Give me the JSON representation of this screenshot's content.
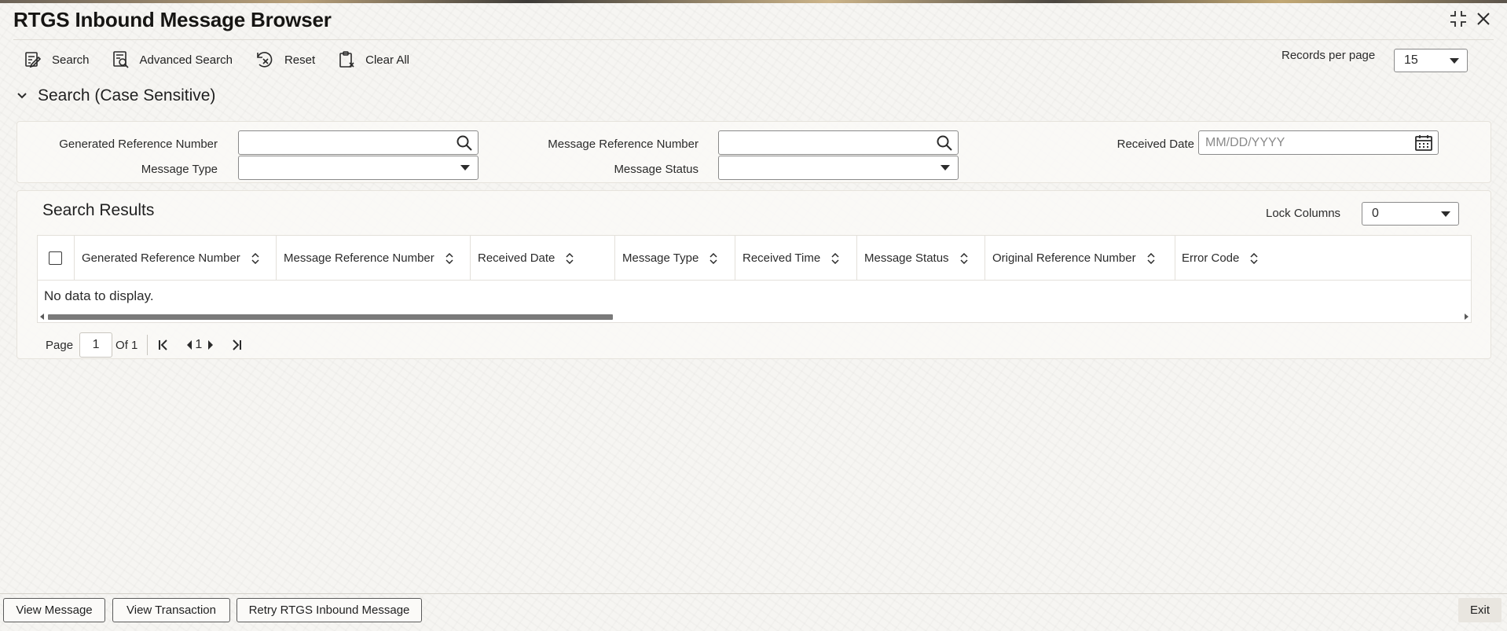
{
  "window": {
    "title": "RTGS Inbound Message Browser"
  },
  "toolbar": {
    "search_label": "Search",
    "advanced_search_label": "Advanced Search",
    "reset_label": "Reset",
    "clear_all_label": "Clear All"
  },
  "records_per_page": {
    "label": "Records per page",
    "value": "15"
  },
  "search_section": {
    "title": "Search (Case Sensitive)",
    "fields": {
      "generated_reference_number": {
        "label": "Generated Reference Number",
        "value": ""
      },
      "message_reference_number": {
        "label": "Message Reference Number",
        "value": ""
      },
      "received_date": {
        "label": "Received Date",
        "placeholder": "MM/DD/YYYY",
        "value": ""
      },
      "message_type": {
        "label": "Message Type",
        "value": ""
      },
      "message_status": {
        "label": "Message Status",
        "value": ""
      }
    }
  },
  "results": {
    "title": "Search Results",
    "lock_columns": {
      "label": "Lock Columns",
      "value": "0"
    },
    "columns": [
      "Generated Reference Number",
      "Message Reference Number",
      "Received Date",
      "Message Type",
      "Received Time",
      "Message Status",
      "Original Reference Number",
      "Error Code"
    ],
    "rows": [],
    "empty_text": "No data to display."
  },
  "pagination": {
    "page_label": "Page",
    "page_value": "1",
    "of_label": "Of 1",
    "current_page": "1"
  },
  "footer": {
    "view_message_label": "View Message",
    "view_transaction_label": "View Transaction",
    "retry_label": "Retry RTGS Inbound Message",
    "exit_label": "Exit"
  }
}
